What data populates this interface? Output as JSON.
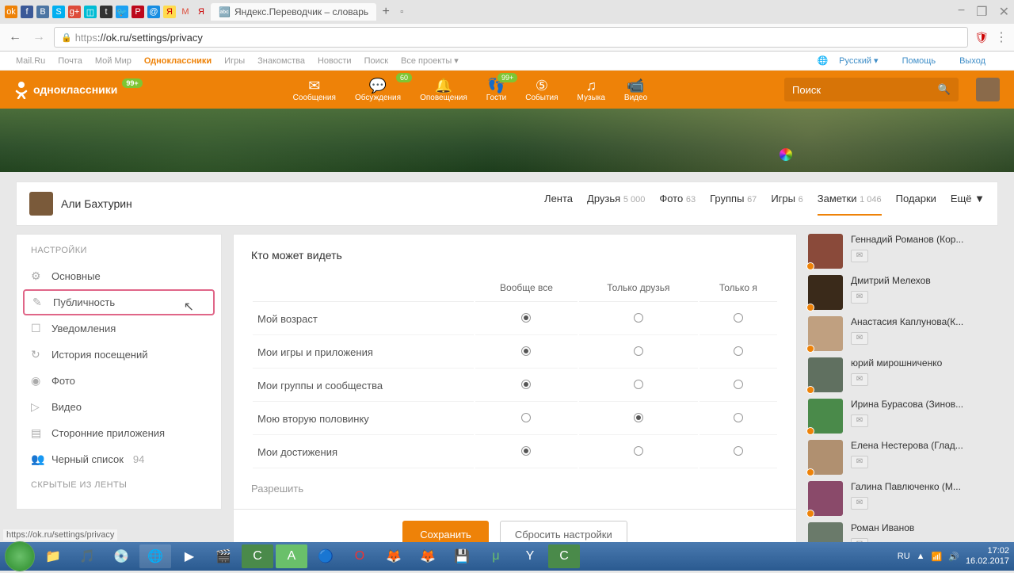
{
  "browser": {
    "tab_title": "Яндекс.Переводчик – словарь",
    "url_proto": "https",
    "url_rest": "://ok.ru/settings/privacy",
    "win_min": "−",
    "win_max": "❐",
    "win_close": "✕"
  },
  "portal": {
    "links": [
      "Mail.Ru",
      "Почта",
      "Мой Мир",
      "Одноклассники",
      "Игры",
      "Знакомства",
      "Новости",
      "Поиск",
      "Все проекты ▾"
    ],
    "active_index": 3,
    "lang": "Русский ▾",
    "help": "Помощь",
    "exit": "Выход"
  },
  "header": {
    "brand": "одноклассники",
    "nav": [
      {
        "label": "Сообщения"
      },
      {
        "label": "Обсуждения",
        "badge": "60"
      },
      {
        "label": "Оповещения"
      },
      {
        "label": "Гости",
        "badge": "99+"
      },
      {
        "label": "События"
      },
      {
        "label": "Музыка"
      },
      {
        "label": "Видео"
      }
    ],
    "brand_badge": "99+",
    "search_placeholder": "Поиск"
  },
  "profile": {
    "name": "Али Бахтурин",
    "tabs": [
      {
        "label": "Лента"
      },
      {
        "label": "Друзья",
        "count": "5 000"
      },
      {
        "label": "Фото",
        "count": "63"
      },
      {
        "label": "Группы",
        "count": "67"
      },
      {
        "label": "Игры",
        "count": "6"
      },
      {
        "label": "Заметки",
        "count": "1 046"
      },
      {
        "label": "Подарки"
      },
      {
        "label": "Ещё ▼"
      }
    ],
    "active_tab": 5
  },
  "settings": {
    "header": "НАСТРОЙКИ",
    "items": [
      {
        "icon": "⚙",
        "label": "Основные"
      },
      {
        "icon": "✎",
        "label": "Публичность",
        "highlighted": true
      },
      {
        "icon": "☐",
        "label": "Уведомления"
      },
      {
        "icon": "↻",
        "label": "История посещений"
      },
      {
        "icon": "◉",
        "label": "Фото"
      },
      {
        "icon": "▷",
        "label": "Видео"
      },
      {
        "icon": "▤",
        "label": "Сторонние приложения"
      },
      {
        "icon": "👥",
        "label": "Черный список",
        "count": "94"
      }
    ],
    "header2": "СКРЫТЫЕ ИЗ ЛЕНТЫ"
  },
  "privacy": {
    "title": "Кто может видеть",
    "cols": [
      "",
      "Вообще все",
      "Только друзья",
      "Только я"
    ],
    "rows": [
      {
        "label": "Мой возраст",
        "sel": 0
      },
      {
        "label": "Мои игры и приложения",
        "sel": 0
      },
      {
        "label": "Мои группы и сообщества",
        "sel": 0
      },
      {
        "label": "Мою вторую половинку",
        "sel": 1
      },
      {
        "label": "Мои достижения",
        "sel": 0
      }
    ],
    "next_section": "Разрешить",
    "save": "Сохранить",
    "reset": "Сбросить настройки"
  },
  "friends": [
    {
      "name": "Геннадий Романов (Кор...",
      "bg": "#8a4a3a"
    },
    {
      "name": "Дмитрий Мелехов",
      "bg": "#3a2a1a"
    },
    {
      "name": "Анастасия Каплунова(К...",
      "bg": "#c0a080"
    },
    {
      "name": "юрий мирошниченко",
      "bg": "#607060"
    },
    {
      "name": "Ирина Бурасова (Зинов...",
      "bg": "#4a8a4a"
    },
    {
      "name": "Елена Нестерова (Глад...",
      "bg": "#b09070"
    },
    {
      "name": "Галина Павлюченко (М...",
      "bg": "#8a4a6a"
    },
    {
      "name": "Роман Иванов",
      "bg": "#6a7a6a"
    }
  ],
  "taskbar": {
    "lang": "RU",
    "time": "17:02",
    "date": "16.02.2017"
  },
  "status_url": "https://ok.ru/settings/privacy"
}
